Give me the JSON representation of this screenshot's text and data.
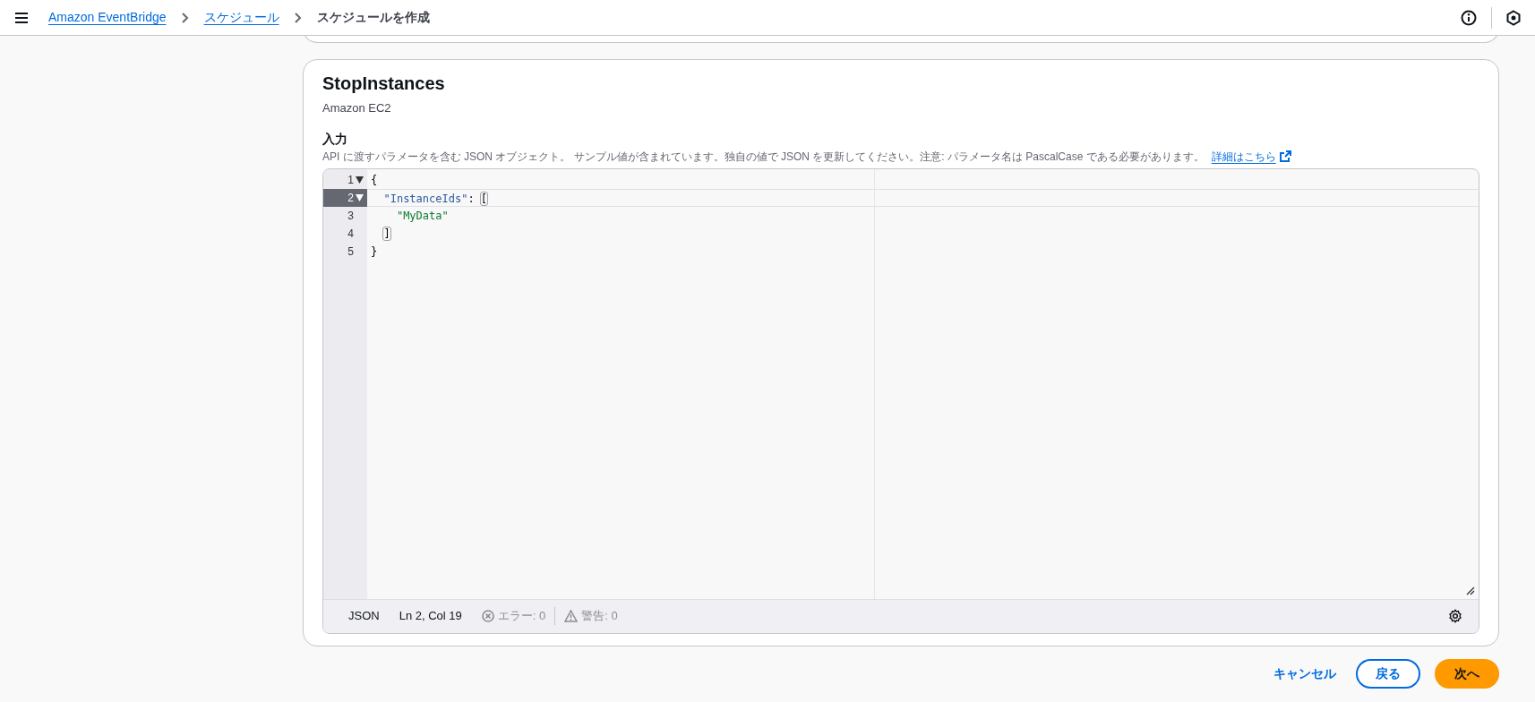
{
  "breadcrumbs": [
    {
      "label": "Amazon EventBridge",
      "kind": "link"
    },
    {
      "label": "スケジュール",
      "kind": "link"
    },
    {
      "label": "スケジュールを作成",
      "kind": "current"
    }
  ],
  "card": {
    "title": "StopInstances",
    "subtitle": "Amazon EC2",
    "field_label": "入力",
    "description": "API に渡すパラメータを含む JSON オブジェクト。 サンプル値が含まれています。独自の値で JSON を更新してください。注意: パラメータ名は PascalCase である必要があります。",
    "link": "詳細はこちら"
  },
  "editor": {
    "lines": [
      {
        "number": "1",
        "foldable": true,
        "active": false,
        "tokens": [
          {
            "text": "{",
            "kind": "punct",
            "matched": false
          }
        ]
      },
      {
        "number": "2",
        "foldable": true,
        "active": true,
        "tokens": [
          {
            "text": "  \"InstanceIds\"",
            "kind": "key",
            "matched": false
          },
          {
            "text": ": ",
            "kind": "punct",
            "matched": false
          },
          {
            "text": "[",
            "kind": "punct",
            "matched": true
          }
        ]
      },
      {
        "number": "3",
        "foldable": false,
        "active": false,
        "tokens": [
          {
            "text": "    \"MyData\"",
            "kind": "string",
            "matched": false
          }
        ]
      },
      {
        "number": "4",
        "foldable": false,
        "active": false,
        "tokens": [
          {
            "text": "  ]",
            "kind": "punct",
            "matched": true
          }
        ]
      },
      {
        "number": "5",
        "foldable": false,
        "active": false,
        "tokens": [
          {
            "text": "}",
            "kind": "punct",
            "matched": false
          }
        ]
      }
    ],
    "status": {
      "language": "JSON",
      "position": "Ln 2, Col 19",
      "errors": "エラー: 0",
      "warnings": "警告: 0"
    }
  },
  "actions": [
    {
      "label": "キャンセル",
      "kind": "link"
    },
    {
      "label": "戻る",
      "kind": "secondary"
    },
    {
      "label": "次へ",
      "kind": "primary"
    }
  ]
}
